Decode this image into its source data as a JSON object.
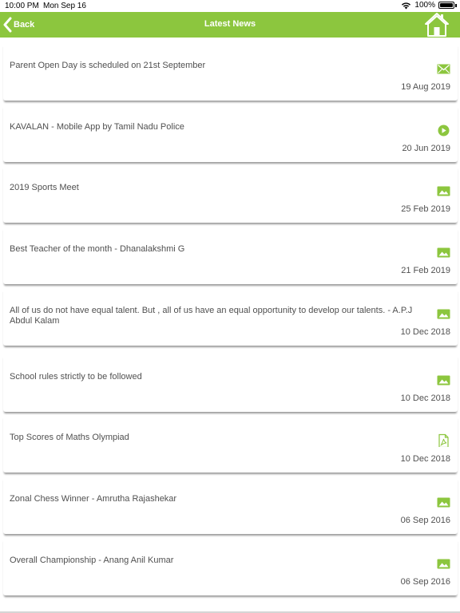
{
  "status_bar": {
    "time": "10:00 PM",
    "date": "Mon Sep 16",
    "battery": "100%"
  },
  "navbar": {
    "back_label": "Back",
    "title": "Latest News"
  },
  "accent_color": "#8cc63e",
  "news": [
    {
      "title": "Parent Open Day is scheduled on 21st September",
      "date": "19 Aug 2019",
      "icon": "mail-icon"
    },
    {
      "title": "KAVALAN -  Mobile App by Tamil Nadu Police",
      "date": "20 Jun 2019",
      "icon": "play-icon"
    },
    {
      "title": "2019 Sports Meet",
      "date": "25 Feb 2019",
      "icon": "image-icon"
    },
    {
      "title": "Best Teacher of the month - Dhanalakshmi G",
      "date": "21 Feb 2019",
      "icon": "image-icon"
    },
    {
      "title": "All of us do not have equal talent. But , all of us have an equal opportunity to develop our talents. - A.P.J Abdul Kalam",
      "date": "10 Dec 2018",
      "icon": "image-icon"
    },
    {
      "title": "School rules strictly to be followed",
      "date": "10 Dec 2018",
      "icon": "image-icon"
    },
    {
      "title": "Top Scores of Maths Olympiad",
      "date": "10 Dec 2018",
      "icon": "pdf-icon"
    },
    {
      "title": "Zonal Chess Winner - Amrutha Rajashekar",
      "date": "06 Sep 2016",
      "icon": "image-icon"
    },
    {
      "title": "Overall Championship - Anang Anil Kumar",
      "date": "06 Sep 2016",
      "icon": "image-icon"
    }
  ]
}
